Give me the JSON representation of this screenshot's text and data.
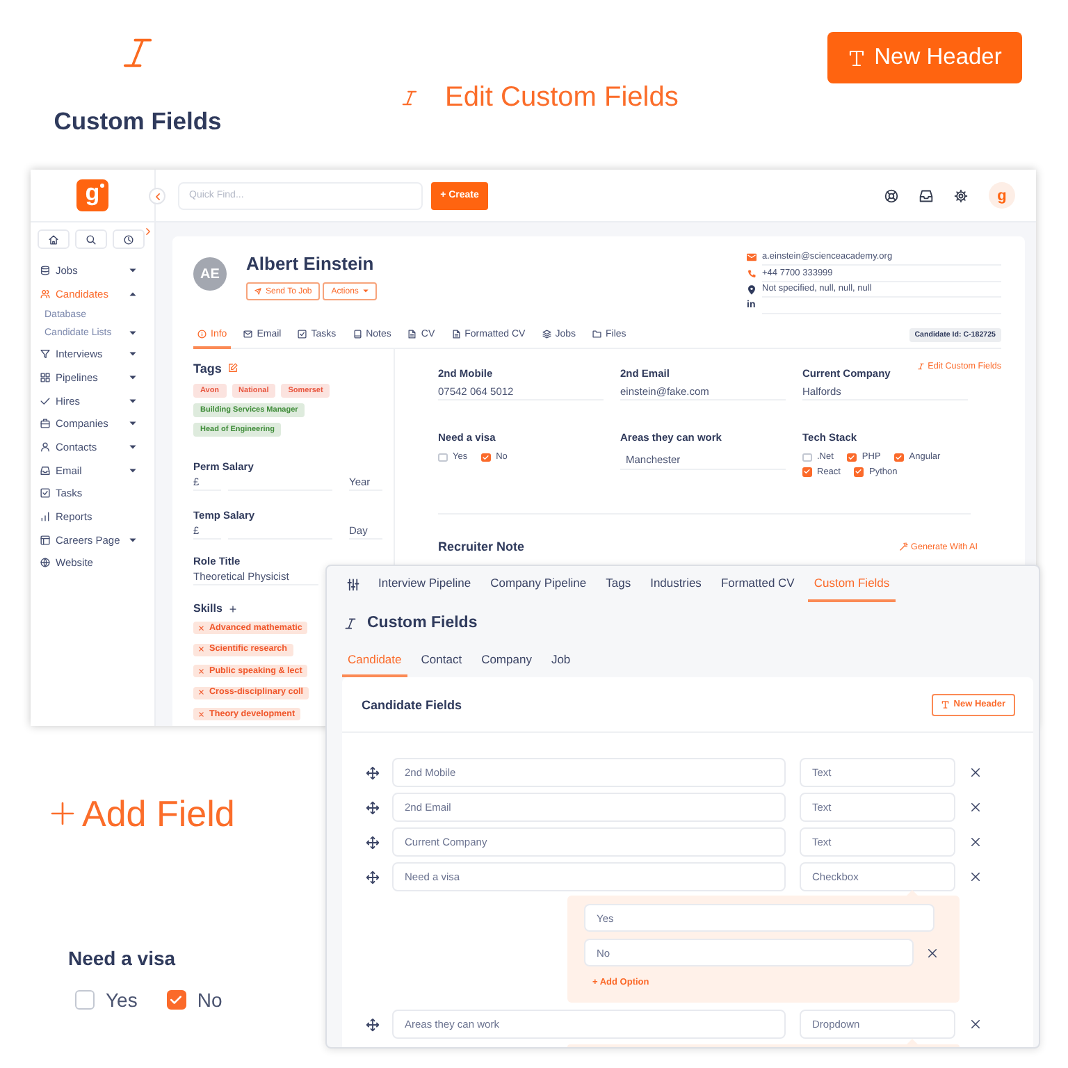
{
  "promo": {
    "heading": "Custom Fields",
    "edit_link": "Edit Custom Fields",
    "new_header_button": "New Header",
    "add_field": "Add Field",
    "visa_field": {
      "label": "Need a visa",
      "options": [
        {
          "label": "Yes",
          "checked": false
        },
        {
          "label": "No",
          "checked": true
        }
      ]
    }
  },
  "app": {
    "logo": "g",
    "search": {
      "placeholder": "Quick Find..."
    },
    "create_button": "+ Create",
    "account_avatar": "g",
    "sidebar": {
      "items": [
        {
          "label": "Jobs",
          "selected": false,
          "expanded": false
        },
        {
          "label": "Candidates",
          "selected": true,
          "expanded": true,
          "children": [
            {
              "label": "Database",
              "selected": false
            },
            {
              "label": "Candidate Lists",
              "selected": false,
              "expanded": false
            }
          ]
        },
        {
          "label": "Interviews",
          "selected": false,
          "expanded": false
        },
        {
          "label": "Pipelines",
          "selected": false,
          "expanded": false
        },
        {
          "label": "Hires",
          "selected": false,
          "expanded": false
        },
        {
          "label": "Companies",
          "selected": false,
          "expanded": false
        },
        {
          "label": "Contacts",
          "selected": false,
          "expanded": false
        },
        {
          "label": "Email",
          "selected": false,
          "expanded": false
        },
        {
          "label": "Tasks",
          "selected": false
        },
        {
          "label": "Reports",
          "selected": false
        },
        {
          "label": "Careers Page",
          "selected": false,
          "expanded": false
        },
        {
          "label": "Website",
          "selected": false
        }
      ]
    },
    "profile": {
      "initials": "AE",
      "name": "Albert Einstein",
      "actions": [
        {
          "label": "Send To Job",
          "kind": "send"
        },
        {
          "label": "Actions",
          "kind": "menu"
        }
      ],
      "contact": [
        {
          "kind": "email",
          "text": "a.einstein@scienceacademy.org"
        },
        {
          "kind": "phone",
          "text": "+44 7700 333999"
        },
        {
          "kind": "location",
          "text": "Not specified, null, null, null"
        },
        {
          "kind": "social",
          "badge": "in"
        }
      ],
      "tabs": [
        {
          "label": "Info",
          "selected": true
        },
        {
          "label": "Email",
          "selected": false
        },
        {
          "label": "Tasks",
          "selected": false
        },
        {
          "label": "Notes",
          "selected": false
        },
        {
          "label": "CV",
          "selected": false
        },
        {
          "label": "Formatted CV",
          "selected": false
        },
        {
          "label": "Jobs",
          "selected": false
        },
        {
          "label": "Files",
          "selected": false
        }
      ],
      "candidate_id": "Candidate Id: C-182725",
      "tags": {
        "title": "Tags",
        "items": [
          {
            "label": "Avon",
            "color": "#e8563f"
          },
          {
            "label": "National",
            "color": "#e8563f"
          },
          {
            "label": "Somerset",
            "color": "#e8563f"
          },
          {
            "label": "Building Services Manager",
            "color": "#3d8b37"
          },
          {
            "label": "Head of Engineering",
            "color": "#3d8b37"
          }
        ]
      },
      "salaries": [
        {
          "label": "Perm Salary",
          "currency": "£",
          "period": "Year"
        },
        {
          "label": "Temp Salary",
          "currency": "£",
          "period": "Day"
        }
      ],
      "role": {
        "label": "Role Title",
        "value": "Theoretical Physicist"
      },
      "skills": {
        "title": "Skills",
        "add": "+",
        "items": [
          "Advanced mathematic",
          "Scientific research",
          "Public speaking & lect",
          "Cross-disciplinary coll",
          "Theory development"
        ]
      },
      "custom_fields": {
        "edit_link": "Edit Custom Fields",
        "fields": [
          {
            "label": "2nd Mobile",
            "kind": "text",
            "value": "07542 064 5012"
          },
          {
            "label": "2nd Email",
            "kind": "text",
            "value": "einstein@fake.com"
          },
          {
            "label": "Current Company",
            "kind": "text",
            "value": "Halfords"
          },
          {
            "label": "Need a visa",
            "kind": "checkbox",
            "options": [
              {
                "label": "Yes",
                "checked": false
              },
              {
                "label": "No",
                "checked": true
              }
            ]
          },
          {
            "label": "Areas they can work",
            "kind": "dropdown",
            "value": "Manchester"
          },
          {
            "label": "Tech Stack",
            "kind": "checkbox",
            "options": [
              {
                "label": ".Net",
                "checked": false
              },
              {
                "label": "PHP",
                "checked": true
              },
              {
                "label": "Angular",
                "checked": true
              },
              {
                "label": "React",
                "checked": true
              },
              {
                "label": "Python",
                "checked": true
              }
            ]
          }
        ]
      },
      "recruiter_note": {
        "title": "Recruiter Note",
        "action": "Generate With AI"
      }
    }
  },
  "settings_window": {
    "tabs": [
      {
        "label": "Interview Pipeline",
        "selected": false
      },
      {
        "label": "Company Pipeline",
        "selected": false
      },
      {
        "label": "Tags",
        "selected": false
      },
      {
        "label": "Industries",
        "selected": false
      },
      {
        "label": "Formatted CV",
        "selected": false
      },
      {
        "label": "Custom Fields",
        "selected": true
      }
    ],
    "title": "Custom Fields",
    "subtabs": [
      {
        "label": "Candidate",
        "selected": true
      },
      {
        "label": "Contact",
        "selected": false
      },
      {
        "label": "Company",
        "selected": false
      },
      {
        "label": "Job",
        "selected": false
      }
    ],
    "section": {
      "title": "Candidate Fields",
      "button": "New Header",
      "rows": [
        {
          "name": "2nd Mobile",
          "type": "Text",
          "expanded": false
        },
        {
          "name": "2nd Email",
          "type": "Text",
          "expanded": false
        },
        {
          "name": "Current Company",
          "type": "Text",
          "expanded": false
        },
        {
          "name": "Need a visa",
          "type": "Checkbox",
          "expanded": true,
          "options": [
            {
              "label": "Yes",
              "removable": false
            },
            {
              "label": "No",
              "removable": true
            }
          ],
          "add_option": "+ Add Option"
        },
        {
          "name": "Areas they can work",
          "type": "Dropdown",
          "expanded": true
        }
      ]
    }
  }
}
